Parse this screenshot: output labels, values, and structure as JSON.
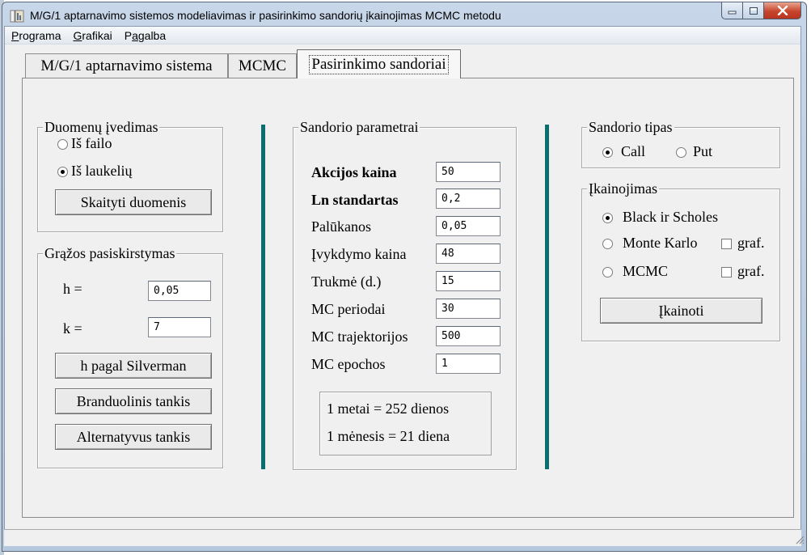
{
  "window": {
    "title": "M/G/1 aptarnavimo sistemos modeliavimas ir pasirinkimo sandorių įkainojimas MCMC metodu"
  },
  "menu": [
    {
      "pre": "",
      "ul": "P",
      "post": "rograma"
    },
    {
      "pre": "",
      "ul": "G",
      "post": "rafikai"
    },
    {
      "pre": "P",
      "ul": "a",
      "post": "galba"
    }
  ],
  "tabs": {
    "t1": "M/G/1 aptarnavimo sistema",
    "t2": "MCMC",
    "t3": "Pasirinkimo sandoriai"
  },
  "data_input": {
    "legend": "Duomenų įvedimas",
    "from_file": "Iš failo",
    "from_fields": "Iš laukelių",
    "read_button": "Skaityti duomenis"
  },
  "returns": {
    "legend": "Grąžos pasiskirstymas",
    "h_label": "h =",
    "h_value": "0,05",
    "k_label": "k =",
    "k_value": "7",
    "silverman_button": "h pagal Silverman",
    "kernel_button": "Branduolinis tankis",
    "alt_button": "Alternatyvus tankis"
  },
  "params": {
    "legend": "Sandorio parametrai",
    "rows": [
      {
        "label": "Akcijos kaina",
        "value": "50"
      },
      {
        "label": "Ln standartas",
        "value": "0,2"
      },
      {
        "label": "Palūkanos",
        "value": "0,05"
      },
      {
        "label": "Įvykdymo kaina",
        "value": "48"
      },
      {
        "label": "Trukmė (d.)",
        "value": "15"
      },
      {
        "label": "MC periodai",
        "value": "30"
      },
      {
        "label": "MC trajektorijos",
        "value": "500"
      },
      {
        "label": "MC epochos",
        "value": "1"
      }
    ],
    "note1": "1 metai = 252 dienos",
    "note2": "1 mėnesis = 21 diena"
  },
  "deal_type": {
    "legend": "Sandorio tipas",
    "call": "Call",
    "put": "Put"
  },
  "pricing": {
    "legend": "Įkainojimas",
    "bs": "Black ir Scholes",
    "mc": "Monte Karlo",
    "mcmc": "MCMC",
    "graf1": "graf.",
    "graf2": "graf.",
    "button": "Įkainoti"
  },
  "colors": {
    "separator": "#0b6e6e",
    "close_button": "#c7452c"
  }
}
